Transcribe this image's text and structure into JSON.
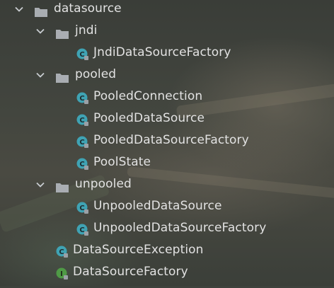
{
  "tree": {
    "root": {
      "label": "datasource",
      "expanded": true
    },
    "jndi": {
      "label": "jndi",
      "expanded": true,
      "children": [
        "JndiDataSourceFactory"
      ]
    },
    "pooled": {
      "label": "pooled",
      "expanded": true,
      "children": [
        "PooledConnection",
        "PooledDataSource",
        "PooledDataSourceFactory",
        "PoolState"
      ]
    },
    "unpooled": {
      "label": "unpooled",
      "expanded": true,
      "children": [
        "UnpooledDataSource",
        "UnpooledDataSourceFactory"
      ]
    },
    "files": [
      {
        "label": "DataSourceException",
        "kind": "class"
      },
      {
        "label": "DataSourceFactory",
        "kind": "interface"
      }
    ]
  },
  "icons": {
    "class_letter": "C",
    "interface_letter": "I",
    "class_color": "#3fa3b4",
    "interface_color": "#4f9a46",
    "folder_color": "#a9adb2",
    "lock_color": "#9aa0a6"
  }
}
